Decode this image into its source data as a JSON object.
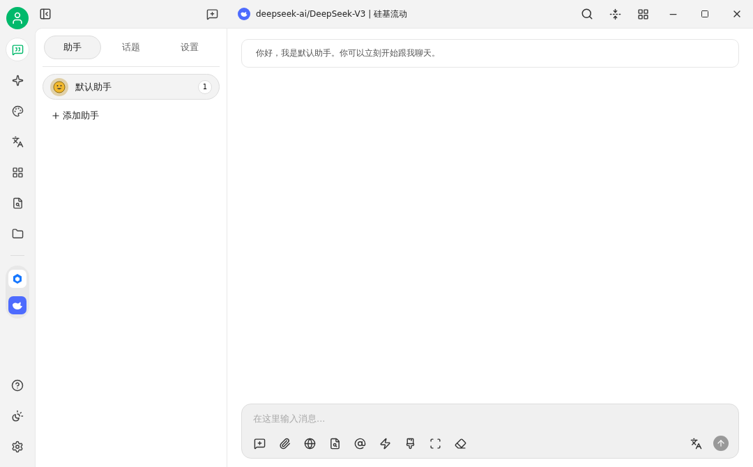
{
  "rail": {
    "items": [
      {
        "selected": true
      },
      {
        "selected": false
      },
      {
        "selected": false
      },
      {
        "selected": false
      },
      {
        "selected": false
      },
      {
        "selected": false
      },
      {
        "selected": false
      }
    ]
  },
  "header": {
    "model": "deepseek-ai/DeepSeek-V3 | 硅基流动"
  },
  "sidebar": {
    "tabs": [
      {
        "label": "助手",
        "selected": true
      },
      {
        "label": "话题",
        "selected": false
      },
      {
        "label": "设置",
        "selected": false
      }
    ],
    "assistants": [
      {
        "name": "默认助手",
        "count": "1",
        "selected": true
      }
    ],
    "add_label": "添加助手"
  },
  "chat": {
    "messages": [
      "你好，我是默认助手。你可以立刻开始跟我聊天。"
    ],
    "input": {
      "placeholder": "在这里输入消息..."
    }
  }
}
